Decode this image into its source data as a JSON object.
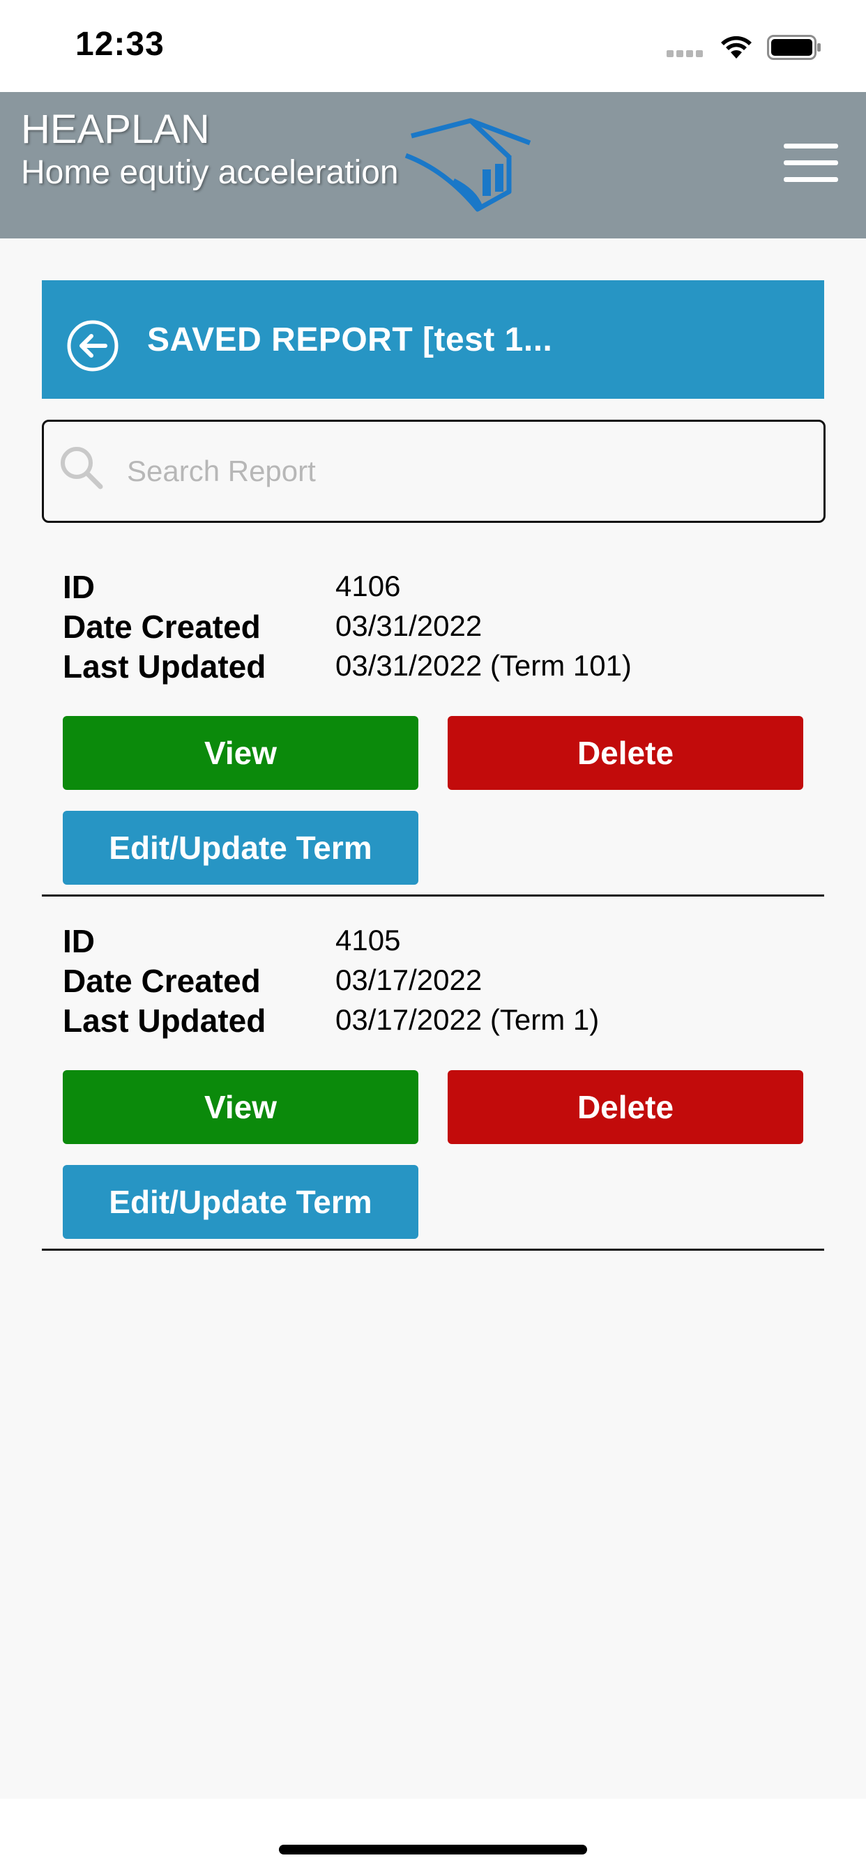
{
  "status_bar": {
    "time": "12:33"
  },
  "header": {
    "title": "HEAPLAN",
    "subtitle": "Home equtiy acceleration",
    "logo": "house-logo-icon",
    "menu_icon": "hamburger-menu-icon"
  },
  "title_bar": {
    "title": "SAVED REPORT [test 1...",
    "back_icon": "back-arrow-circle-icon"
  },
  "search": {
    "placeholder": "Search Report",
    "value": ""
  },
  "labels": {
    "id": "ID",
    "date_created": "Date Created",
    "last_updated": "Last Updated"
  },
  "reports": [
    {
      "id": "4106",
      "date_created": "03/31/2022",
      "last_updated": "03/31/2022 (Term 101)",
      "view_label": "View",
      "delete_label": "Delete",
      "edit_label": "Edit/Update Term"
    },
    {
      "id": "4105",
      "date_created": "03/17/2022",
      "last_updated": "03/17/2022 (Term 1)",
      "view_label": "View",
      "delete_label": "Delete",
      "edit_label": "Edit/Update Term"
    }
  ],
  "colors": {
    "header_bg": "#8a979e",
    "accent": "#2795c4",
    "view": "#0b8a0b",
    "delete": "#c20b0b"
  }
}
